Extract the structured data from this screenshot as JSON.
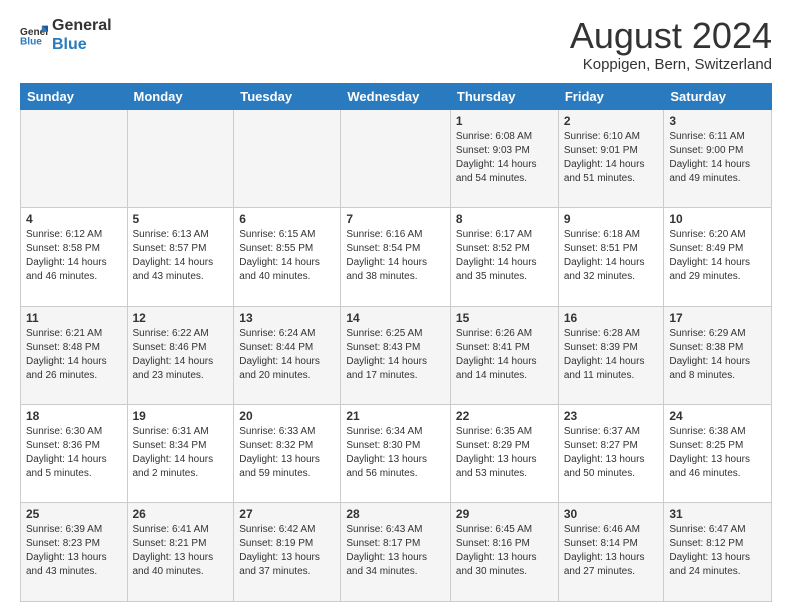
{
  "header": {
    "logo_line1": "General",
    "logo_line2": "Blue",
    "month_title": "August 2024",
    "location": "Koppigen, Bern, Switzerland"
  },
  "days_of_week": [
    "Sunday",
    "Monday",
    "Tuesday",
    "Wednesday",
    "Thursday",
    "Friday",
    "Saturday"
  ],
  "weeks": [
    [
      {
        "day": "",
        "info": ""
      },
      {
        "day": "",
        "info": ""
      },
      {
        "day": "",
        "info": ""
      },
      {
        "day": "",
        "info": ""
      },
      {
        "day": "1",
        "info": "Sunrise: 6:08 AM\nSunset: 9:03 PM\nDaylight: 14 hours\nand 54 minutes."
      },
      {
        "day": "2",
        "info": "Sunrise: 6:10 AM\nSunset: 9:01 PM\nDaylight: 14 hours\nand 51 minutes."
      },
      {
        "day": "3",
        "info": "Sunrise: 6:11 AM\nSunset: 9:00 PM\nDaylight: 14 hours\nand 49 minutes."
      }
    ],
    [
      {
        "day": "4",
        "info": "Sunrise: 6:12 AM\nSunset: 8:58 PM\nDaylight: 14 hours\nand 46 minutes."
      },
      {
        "day": "5",
        "info": "Sunrise: 6:13 AM\nSunset: 8:57 PM\nDaylight: 14 hours\nand 43 minutes."
      },
      {
        "day": "6",
        "info": "Sunrise: 6:15 AM\nSunset: 8:55 PM\nDaylight: 14 hours\nand 40 minutes."
      },
      {
        "day": "7",
        "info": "Sunrise: 6:16 AM\nSunset: 8:54 PM\nDaylight: 14 hours\nand 38 minutes."
      },
      {
        "day": "8",
        "info": "Sunrise: 6:17 AM\nSunset: 8:52 PM\nDaylight: 14 hours\nand 35 minutes."
      },
      {
        "day": "9",
        "info": "Sunrise: 6:18 AM\nSunset: 8:51 PM\nDaylight: 14 hours\nand 32 minutes."
      },
      {
        "day": "10",
        "info": "Sunrise: 6:20 AM\nSunset: 8:49 PM\nDaylight: 14 hours\nand 29 minutes."
      }
    ],
    [
      {
        "day": "11",
        "info": "Sunrise: 6:21 AM\nSunset: 8:48 PM\nDaylight: 14 hours\nand 26 minutes."
      },
      {
        "day": "12",
        "info": "Sunrise: 6:22 AM\nSunset: 8:46 PM\nDaylight: 14 hours\nand 23 minutes."
      },
      {
        "day": "13",
        "info": "Sunrise: 6:24 AM\nSunset: 8:44 PM\nDaylight: 14 hours\nand 20 minutes."
      },
      {
        "day": "14",
        "info": "Sunrise: 6:25 AM\nSunset: 8:43 PM\nDaylight: 14 hours\nand 17 minutes."
      },
      {
        "day": "15",
        "info": "Sunrise: 6:26 AM\nSunset: 8:41 PM\nDaylight: 14 hours\nand 14 minutes."
      },
      {
        "day": "16",
        "info": "Sunrise: 6:28 AM\nSunset: 8:39 PM\nDaylight: 14 hours\nand 11 minutes."
      },
      {
        "day": "17",
        "info": "Sunrise: 6:29 AM\nSunset: 8:38 PM\nDaylight: 14 hours\nand 8 minutes."
      }
    ],
    [
      {
        "day": "18",
        "info": "Sunrise: 6:30 AM\nSunset: 8:36 PM\nDaylight: 14 hours\nand 5 minutes."
      },
      {
        "day": "19",
        "info": "Sunrise: 6:31 AM\nSunset: 8:34 PM\nDaylight: 14 hours\nand 2 minutes."
      },
      {
        "day": "20",
        "info": "Sunrise: 6:33 AM\nSunset: 8:32 PM\nDaylight: 13 hours\nand 59 minutes."
      },
      {
        "day": "21",
        "info": "Sunrise: 6:34 AM\nSunset: 8:30 PM\nDaylight: 13 hours\nand 56 minutes."
      },
      {
        "day": "22",
        "info": "Sunrise: 6:35 AM\nSunset: 8:29 PM\nDaylight: 13 hours\nand 53 minutes."
      },
      {
        "day": "23",
        "info": "Sunrise: 6:37 AM\nSunset: 8:27 PM\nDaylight: 13 hours\nand 50 minutes."
      },
      {
        "day": "24",
        "info": "Sunrise: 6:38 AM\nSunset: 8:25 PM\nDaylight: 13 hours\nand 46 minutes."
      }
    ],
    [
      {
        "day": "25",
        "info": "Sunrise: 6:39 AM\nSunset: 8:23 PM\nDaylight: 13 hours\nand 43 minutes."
      },
      {
        "day": "26",
        "info": "Sunrise: 6:41 AM\nSunset: 8:21 PM\nDaylight: 13 hours\nand 40 minutes."
      },
      {
        "day": "27",
        "info": "Sunrise: 6:42 AM\nSunset: 8:19 PM\nDaylight: 13 hours\nand 37 minutes."
      },
      {
        "day": "28",
        "info": "Sunrise: 6:43 AM\nSunset: 8:17 PM\nDaylight: 13 hours\nand 34 minutes."
      },
      {
        "day": "29",
        "info": "Sunrise: 6:45 AM\nSunset: 8:16 PM\nDaylight: 13 hours\nand 30 minutes."
      },
      {
        "day": "30",
        "info": "Sunrise: 6:46 AM\nSunset: 8:14 PM\nDaylight: 13 hours\nand 27 minutes."
      },
      {
        "day": "31",
        "info": "Sunrise: 6:47 AM\nSunset: 8:12 PM\nDaylight: 13 hours\nand 24 minutes."
      }
    ]
  ]
}
